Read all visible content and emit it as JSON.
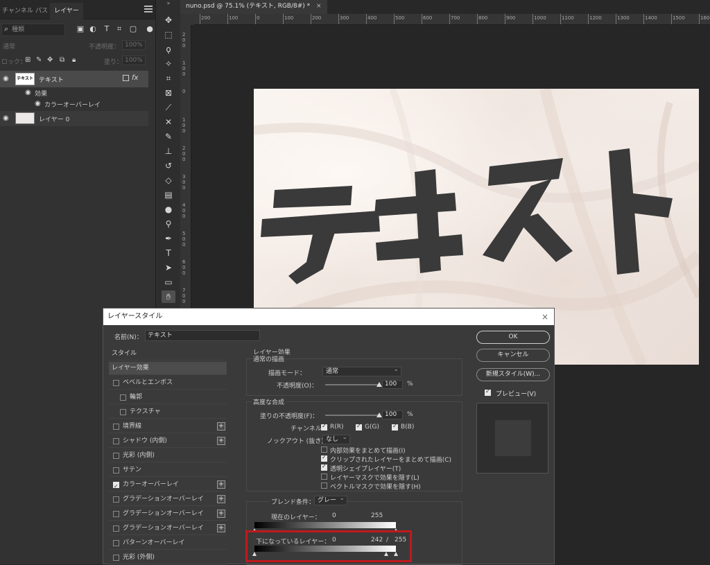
{
  "panel": {
    "tabs": [
      "チャンネル",
      "パス",
      "レイヤー"
    ],
    "filter_placeholder": "種類",
    "blend_mode": "通常",
    "opacity_label": "不透明度：",
    "opacity_value": "100%",
    "lock_label": "ロック：",
    "fill_label": "塗り：",
    "fill_value": "100%",
    "layers": [
      {
        "name": "テキスト",
        "thumb_text": "テキスト",
        "fx": "fx"
      },
      {
        "effects_label": "効果"
      },
      {
        "overlay_label": "カラーオーバーレイ"
      },
      {
        "name": "レイヤー 0"
      }
    ]
  },
  "toolbar": {
    "top_label": "»"
  },
  "document": {
    "tab_title": "nuno.psd @ 75.1% (テキスト, RGB/8#) *",
    "tab_close": "×",
    "ruler_h": [
      "200",
      "100",
      "0",
      "100",
      "200",
      "300",
      "400",
      "500",
      "600",
      "700",
      "800",
      "900",
      "1000",
      "1100",
      "1200",
      "1300",
      "1400",
      "1500",
      "1600"
    ],
    "ruler_v": [
      "200",
      "100",
      "0",
      "100",
      "200",
      "300",
      "400",
      "500",
      "600",
      "700",
      "800"
    ],
    "canvas_text": "テキスト"
  },
  "dialog": {
    "title": "レイヤースタイル",
    "close": "×",
    "name_label": "名前(N)：",
    "name_value": "テキスト",
    "style_list": [
      {
        "label": "スタイル",
        "type": "head"
      },
      {
        "label": "レイヤー効果",
        "type": "head",
        "selected": true
      },
      {
        "label": "ベベルとエンボス",
        "checked": false
      },
      {
        "label": "輪郭",
        "checked": false,
        "sub": true
      },
      {
        "label": "テクスチャ",
        "checked": false,
        "sub": true
      },
      {
        "label": "境界線",
        "checked": false,
        "plus": true
      },
      {
        "label": "シャドウ (内側)",
        "checked": false,
        "plus": true
      },
      {
        "label": "光彩 (内側)",
        "checked": false
      },
      {
        "label": "サテン",
        "checked": false
      },
      {
        "label": "カラーオーバーレイ",
        "checked": true,
        "plus": true
      },
      {
        "label": "グラデーションオーバーレイ",
        "checked": false,
        "plus": true
      },
      {
        "label": "グラデーションオーバーレイ",
        "checked": false,
        "plus": true
      },
      {
        "label": "グラデーションオーバーレイ",
        "checked": false,
        "plus": true
      },
      {
        "label": "パターンオーバーレイ",
        "checked": false
      },
      {
        "label": "光彩 (外側)",
        "checked": false
      }
    ],
    "section_title": "レイヤー効果",
    "general": {
      "title": "通常の描画",
      "mode_label": "描画モード：",
      "mode_value": "通常",
      "opacity_label": "不透明度(O)：",
      "opacity_value": "100",
      "opacity_unit": "%",
      "opacity_level": 1.0
    },
    "advanced": {
      "title": "高度な合成",
      "fill_label": "塗りの不透明度(F)：",
      "fill_value": "100",
      "fill_unit": "%",
      "fill_level": 1.0,
      "channels_label": "チャンネル：",
      "channels": [
        {
          "label": "R(R)",
          "checked": true
        },
        {
          "label": "G(G)",
          "checked": true
        },
        {
          "label": "B(B)",
          "checked": true
        }
      ],
      "knockout_label": "ノックアウト (抜き)：",
      "knockout_value": "なし",
      "options": [
        {
          "label": "内部効果をまとめて描画(I)",
          "checked": false
        },
        {
          "label": "クリップされたレイヤーをまとめて描画(C)",
          "checked": true
        },
        {
          "label": "透明シェイプレイヤー(T)",
          "checked": true
        },
        {
          "label": "レイヤーマスクで効果を隠す(L)",
          "checked": false
        },
        {
          "label": "ベクトルマスクで効果を隠す(H)",
          "checked": false
        }
      ]
    },
    "blend_if": {
      "title": "ブレンド条件：",
      "channel_value": "グレー",
      "this_layer_label": "現在のレイヤー：",
      "this_layer_min": "0",
      "this_layer_max": "255",
      "underlying_label": "下になっているレイヤー：",
      "underlying_min": "0",
      "underlying_mid": "242",
      "underlying_slash": "/",
      "underlying_max": "255"
    },
    "buttons": {
      "ok": "OK",
      "cancel": "キャンセル",
      "new_style": "新規スタイル(W)...",
      "preview_label": "プレビュー(V)"
    }
  },
  "colors": {
    "highlight": "#c0191d",
    "text_fill": "#3a3a3a"
  }
}
